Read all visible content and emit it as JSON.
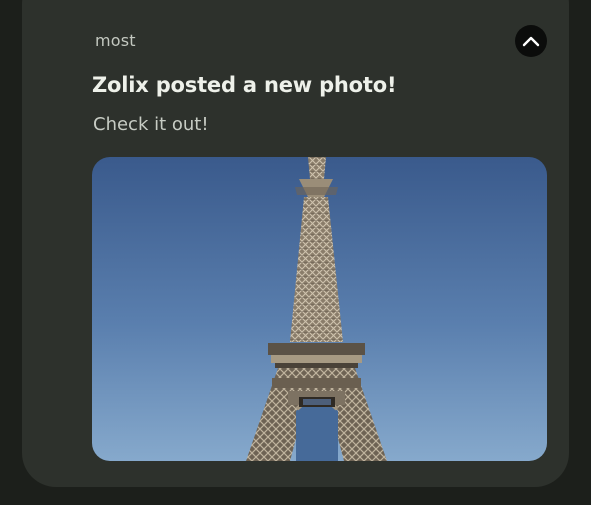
{
  "notification": {
    "app_name": "most",
    "title": "Zolix posted a new photo!",
    "body": "Check it out!",
    "collapse_icon": "chevron-up-icon",
    "image_subject": "eiffel-tower-photo"
  },
  "colors": {
    "background": "#1c1f1b",
    "card": "#2d312c",
    "title_text": "#eef1ea",
    "secondary_text": "#c3c8c0",
    "collapse_button": "#0b0c0b",
    "sky_top": "#3a5a8c",
    "sky_bottom": "#7da3c9"
  }
}
